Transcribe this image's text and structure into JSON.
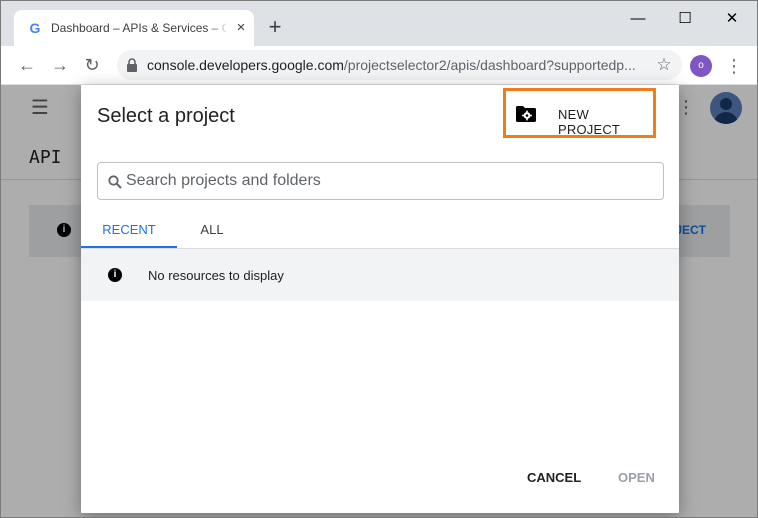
{
  "browser": {
    "tab": {
      "favicon": "G",
      "title": "Dashboard – APIs & Services – Google Cloud",
      "close": "×"
    },
    "new_tab": "+",
    "window_controls": {
      "minimize": "—",
      "maximize": "☐",
      "close": "✕"
    },
    "nav": {
      "back": "←",
      "forward": "→",
      "reload": "↻"
    },
    "address": {
      "host": "console.developers.google.com",
      "path": "/projectselector2/apis/dashboard?supportedp..."
    },
    "bookmark": "☆",
    "profile_initial": "o",
    "menu": "⋮"
  },
  "background": {
    "menu_glyph": "☰",
    "title": "API",
    "banner_button": "JECT",
    "header_menu": "⋮"
  },
  "dialog": {
    "title": "Select a project",
    "new_project_label": "NEW PROJECT",
    "search_placeholder": "Search projects and folders",
    "tabs": {
      "recent": "RECENT",
      "all": "ALL"
    },
    "empty_message": "No resources to display",
    "info_glyph": "i",
    "cancel_label": "CANCEL",
    "open_label": "OPEN",
    "highlight_color": "#f07c1a",
    "accent_color": "#1a73e8"
  }
}
